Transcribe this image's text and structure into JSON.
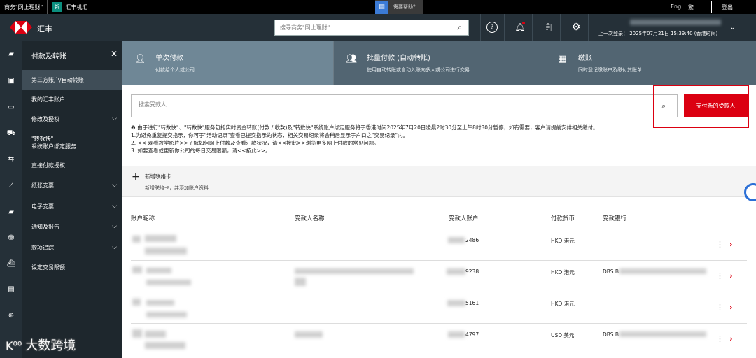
{
  "topbar": {
    "tab1": "商务\"网上理财\"",
    "tab2_logo": "新",
    "tab2": "汇丰机汇",
    "help": "需要帮助？",
    "lang1": "Eng",
    "lang2": "繁",
    "logout": "登出"
  },
  "header": {
    "brand": "汇丰",
    "search_placeholder": "搜寻商务\"网上理财\"",
    "last_login": "上一次登录： 2025年07月21日 15:39:40 (香港时间)"
  },
  "sidebar": {
    "title": "付款及转账",
    "items": [
      {
        "label": "第三方账户/自动转账",
        "active": true
      },
      {
        "label": "我的汇丰账户"
      },
      {
        "label": "修改及授权",
        "expand": true
      },
      {
        "label": "\"转数快\"",
        "label2": "系统账户绑定服务"
      },
      {
        "label": "直接付款授权"
      },
      {
        "label": "纸张支票",
        "expand": true
      },
      {
        "label": "电子支票",
        "expand": true
      },
      {
        "label": "通知及报告",
        "expand": true
      },
      {
        "label": "款项追踪",
        "expand": true
      },
      {
        "label": "设定交易限额"
      }
    ]
  },
  "tabs": [
    {
      "title": "单次付款",
      "sub": "付款给个人或公司",
      "icon": "person-icon",
      "active": true
    },
    {
      "title": "批量付款 (自动转账)",
      "sub": "使用自动转账或自动入账向多人或公司进行交易",
      "icon": "people-icon"
    },
    {
      "title": "缴账",
      "sub": "同时登记缴账户及缴付其账单",
      "icon": "grid-icon"
    }
  ],
  "search": {
    "placeholder": "搜索受款人",
    "pay_new": "支付新的受款人"
  },
  "notice": [
    "❶ 由于进行\"转数快\"、\"转数快\"服务包括实时资金转账(付款 / 收款)及\"转数快\"系统账户绑定服务将于香港时间2025年7月20日凌晨2时30分至上午8时30分暂停，如有需要，客户请提前安排相关缴付。",
    "1.为避免重复提交指示，你可于\"活动记录\"查看已提交指示的状态，相关交易纪录将会稍后显示于户口之\"交易纪录\"内。",
    "2. << 观看教学影片>>了解如何网上付款及查看汇款状况，请<<按此>>浏览更多网上付款的常见问题。",
    "3. 如要查看或更新你公司的每日交易限额，请<<按此>>。"
  ],
  "addcard": {
    "title": "新增联络卡",
    "sub": "新增联络卡，并添加账户资料"
  },
  "table": {
    "headers": [
      "账户昵称",
      "受款人名称",
      "受款人账户",
      "付款货币",
      "受款银行"
    ],
    "rows": [
      {
        "account": "2486",
        "currency": "HKD 港元",
        "bank": ""
      },
      {
        "account": "9238",
        "currency": "HKD 港元",
        "bank": "DBS B"
      },
      {
        "account": "5161",
        "currency": "HKD 港元",
        "bank": ""
      },
      {
        "account": "4797",
        "currency": "USD 美元",
        "bank": "DBS B"
      }
    ]
  },
  "watermark": "大数跨境",
  "colors": {
    "brand_red": "#db0011",
    "header_dark": "#253038",
    "sidebar_dark": "#1e272d",
    "tab_active": "#6f8796",
    "tab_inactive": "#526572"
  }
}
